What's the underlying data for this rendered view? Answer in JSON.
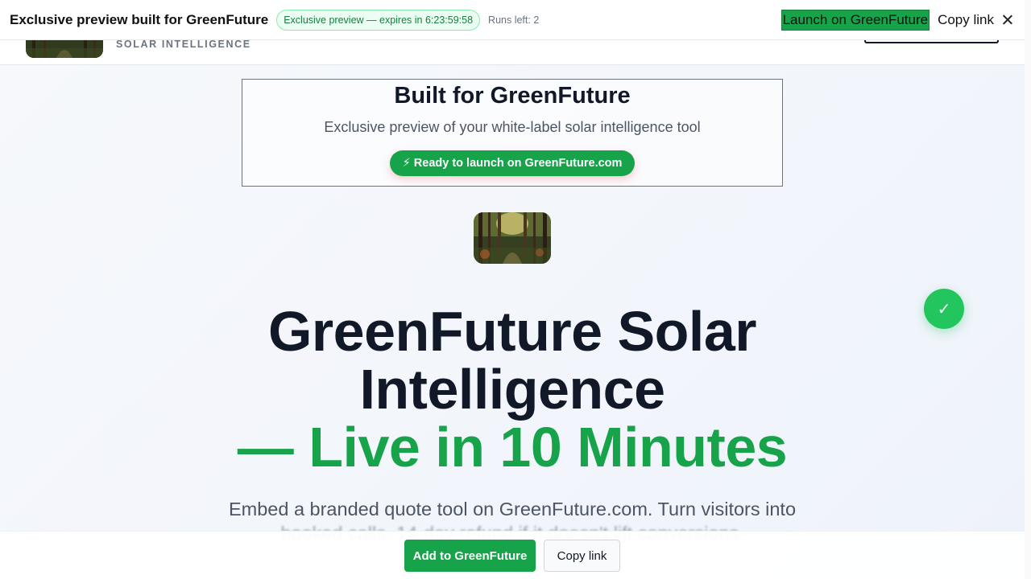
{
  "preview_bar": {
    "title": "Exclusive preview built for GreenFuture",
    "expiry": "Exclusive preview — expires in 6:23:59:58",
    "runs_left": "Runs left: 2",
    "launch_label": "Launch on GreenFuture",
    "copy_label": "Copy link"
  },
  "header": {
    "tagline": "SOLAR INTELLIGENCE"
  },
  "built_card": {
    "title": "Built for GreenFuture",
    "subtitle": "Exclusive preview of your white-label solar intelligence tool",
    "cta": "⚡ Ready to launch on GreenFuture.com"
  },
  "hero": {
    "headline_line1": "GreenFuture Solar",
    "headline_line2": "Intelligence",
    "headline_line3": "— Live in 10 Minutes",
    "description_line1": "Embed a branded quote tool on GreenFuture.com. Turn visitors into",
    "description_line2": "booked calls. 14-day refund if it doesn't lift conversions.",
    "badge_glyph": "✓"
  },
  "bottom_bar": {
    "add_label": "Add to GreenFuture",
    "copy_label": "Copy link"
  },
  "colors": {
    "accent": "#16a34a",
    "badge": "#22c55e",
    "text_dark": "#111827",
    "text_muted": "#4b5563"
  }
}
